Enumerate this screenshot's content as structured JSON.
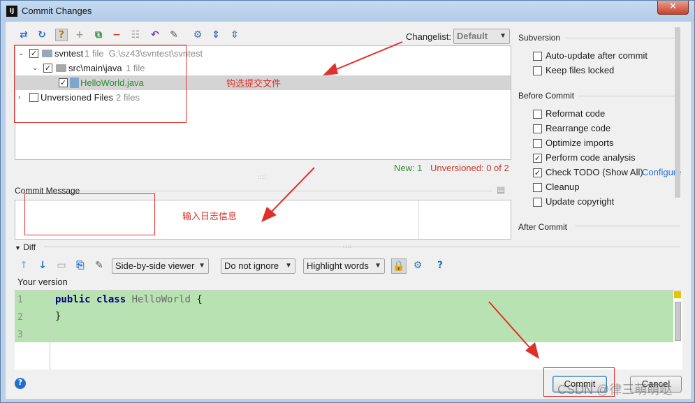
{
  "window": {
    "title": "Commit Changes",
    "app_icon_text": "IJ",
    "close_glyph": "✕"
  },
  "toolbar": {
    "icons": [
      "diff-icon",
      "refresh-icon",
      "changelist-icon",
      "add-icon",
      "move-icon",
      "remove-icon",
      "group-icon",
      "revert-icon",
      "edit-source-icon",
      "settings-icon",
      "expand-all-icon",
      "collapse-all-icon"
    ],
    "changelist_label": "Changelist:",
    "changelist_value": "Default"
  },
  "tree": {
    "rows": [
      {
        "name": "svntest",
        "detail": "1 file  G:\\sz43\\svntest\\svntest"
      },
      {
        "name": "src\\main\\java",
        "detail": "1 file"
      },
      {
        "name": "HelloWorld.java",
        "detail": ""
      },
      {
        "name": "Unversioned Files",
        "detail": "2 files"
      }
    ]
  },
  "status": {
    "new": "New: 1",
    "unversioned": "Unversioned: 0 of 2"
  },
  "annotations": {
    "select_files": "钩选提交文件",
    "enter_log": "输入日志信息"
  },
  "commit_message": {
    "label": "Commit Message",
    "value": ""
  },
  "subversion": {
    "title": "Subversion",
    "options": [
      {
        "label": "Auto-update after commit",
        "checked": false
      },
      {
        "label": "Keep files locked",
        "checked": false
      }
    ]
  },
  "before_commit": {
    "title": "Before Commit",
    "options": [
      {
        "label": "Reformat code",
        "checked": false
      },
      {
        "label": "Rearrange code",
        "checked": false
      },
      {
        "label": "Optimize imports",
        "checked": false
      },
      {
        "label": "Perform code analysis",
        "checked": true
      },
      {
        "label": "Check TODO (Show All)",
        "checked": true,
        "link": "Configure"
      },
      {
        "label": "Cleanup",
        "checked": false
      },
      {
        "label": "Update copyright",
        "checked": false
      }
    ]
  },
  "after_commit": {
    "title": "After Commit"
  },
  "diff": {
    "title": "Diff",
    "viewer": "Side-by-side viewer",
    "ignore": "Do not ignore",
    "highlight": "Highlight words",
    "help_glyph": "?",
    "version_label": "Your version",
    "lines": [
      {
        "num": "1",
        "kw1": "public",
        "kw2": "class",
        "name": "HelloWorld",
        "tail": " {"
      },
      {
        "num": "2",
        "text": "}"
      },
      {
        "num": "3",
        "text": ""
      }
    ]
  },
  "buttons": {
    "commit": "Commit",
    "cancel": "Cancel",
    "help_glyph": "?"
  },
  "watermark": "CSDN @律三萌萌哒",
  "colors": {
    "added_bg": "#b9e2b3",
    "annotation": "#e0302a",
    "new_status": "#2e8b2e",
    "unversioned_status": "#c0392b",
    "link": "#1f6fd1"
  }
}
